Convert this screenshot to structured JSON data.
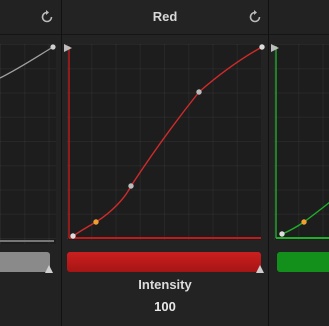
{
  "panels": {
    "left": {
      "curve_color": "#a0a0a0",
      "swatch_color": "#8a8a8a"
    },
    "red": {
      "title": "Red",
      "intensity_label": "Intensity",
      "intensity_value": "100",
      "curve_color": "#d02a2a",
      "swatch_color": "#c01b1b"
    },
    "right": {
      "curve_color": "#1fae2a",
      "swatch_color": "#13901c"
    }
  },
  "icons": {
    "reset": "reset-icon",
    "point": "curve-control-point",
    "handle": "curve-end-handle"
  }
}
